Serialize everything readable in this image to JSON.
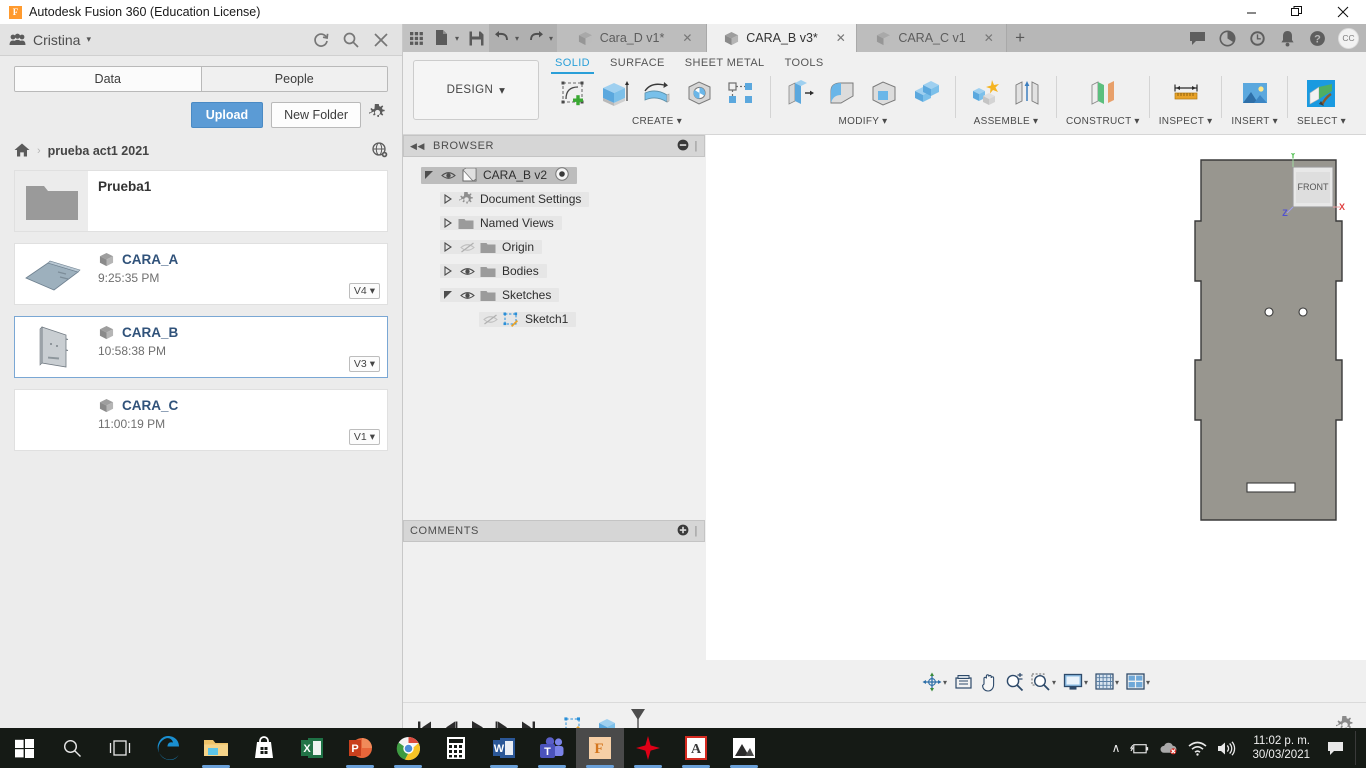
{
  "titlebar": {
    "app_title": "Autodesk Fusion 360 (Education License)",
    "logo_letter": "F",
    "minimize": "—",
    "maximize": "❐",
    "close": "✕"
  },
  "data_panel": {
    "user_name": "Cristina",
    "user_caret": "▾",
    "refresh_icon": "refresh-icon",
    "search_icon": "search-icon",
    "close_icon": "close-icon",
    "tabs": [
      {
        "label": "Data",
        "active": true
      },
      {
        "label": "People",
        "active": false
      }
    ],
    "upload_label": "Upload",
    "new_folder_label": "New Folder",
    "settings_icon": "gear-icon",
    "breadcrumb": {
      "home_icon": "home-icon",
      "separator": "›",
      "current": "prueba act1 2021",
      "globe_icon": "globe-icon"
    },
    "items": [
      {
        "name": "Prueba1",
        "type": "folder",
        "time": "",
        "version": ""
      },
      {
        "name": "CARA_A",
        "type": "file",
        "time": "9:25:35 PM",
        "version": "V4"
      },
      {
        "name": "CARA_B",
        "type": "file",
        "time": "10:58:38 PM",
        "version": "V3",
        "selected": true
      },
      {
        "name": "CARA_C",
        "type": "file",
        "time": "11:00:19 PM",
        "version": "V1"
      }
    ],
    "version_caret": "▾"
  },
  "quick_access": {
    "grid_icon": "app-grid-icon",
    "file_icon": "new-file-icon",
    "save_icon": "save-icon",
    "undo_icon": "undo-icon",
    "redo_icon": "redo-icon",
    "caret": "▾"
  },
  "document_tabs": [
    {
      "label": "Cara_D v1*",
      "active": false,
      "close": "✕"
    },
    {
      "label": "CARA_B v3*",
      "active": true,
      "close": "✕"
    },
    {
      "label": "CARA_C v1",
      "active": false,
      "close": "✕"
    }
  ],
  "tab_add": "+",
  "top_right_icons": [
    "comments-icon",
    "job-status-icon",
    "recent-icon",
    "notifications-icon",
    "help-icon"
  ],
  "avatar_initials": "CC",
  "ribbon": {
    "workspace_label": "DESIGN",
    "workspace_caret": "▾",
    "tabs": [
      {
        "label": "SOLID",
        "active": true
      },
      {
        "label": "SURFACE",
        "active": false
      },
      {
        "label": "SHEET METAL",
        "active": false
      },
      {
        "label": "TOOLS",
        "active": false
      }
    ],
    "groups": [
      {
        "label": "CREATE",
        "caret": "▾",
        "icons": [
          "create-sketch-icon",
          "extrude-icon",
          "revolve-icon",
          "sweep-icon",
          "pattern-icon"
        ]
      },
      {
        "label": "MODIFY",
        "caret": "▾",
        "icons": [
          "press-pull-icon",
          "fillet-icon",
          "shell-icon",
          "combine-icon"
        ]
      },
      {
        "label": "ASSEMBLE",
        "caret": "▾",
        "icons": [
          "new-component-icon",
          "joint-icon"
        ]
      },
      {
        "label": "CONSTRUCT",
        "caret": "▾",
        "icons": [
          "offset-plane-icon"
        ]
      },
      {
        "label": "INSPECT",
        "caret": "▾",
        "icons": [
          "measure-icon"
        ]
      },
      {
        "label": "INSERT",
        "caret": "▾",
        "icons": [
          "insert-image-icon"
        ]
      },
      {
        "label": "SELECT",
        "caret": "▾",
        "icons": [
          "select-icon"
        ]
      }
    ]
  },
  "browser": {
    "title": "BROWSER",
    "collapse_icon": "collapse-left-icon",
    "minimize_icon": "minus-circle-icon",
    "nodes": [
      {
        "label": "CARA_B v2",
        "indent": 0,
        "expander": "expanded",
        "eye": "visible",
        "icon": "component-icon",
        "root": true,
        "activate": "activate-dot-icon"
      },
      {
        "label": "Document Settings",
        "indent": 1,
        "expander": "collapsed",
        "eye": "none",
        "icon": "gear-icon"
      },
      {
        "label": "Named Views",
        "indent": 1,
        "expander": "collapsed",
        "eye": "none",
        "icon": "folder-icon"
      },
      {
        "label": "Origin",
        "indent": 1,
        "expander": "collapsed",
        "eye": "hidden",
        "icon": "folder-icon"
      },
      {
        "label": "Bodies",
        "indent": 1,
        "expander": "collapsed",
        "eye": "visible",
        "icon": "folder-icon"
      },
      {
        "label": "Sketches",
        "indent": 1,
        "expander": "expanded",
        "eye": "visible",
        "icon": "folder-icon"
      },
      {
        "label": "Sketch1",
        "indent": 2,
        "expander": "none",
        "eye": "hidden",
        "icon": "sketch-icon"
      }
    ]
  },
  "comments": {
    "title": "COMMENTS",
    "add_icon": "plus-circle-icon"
  },
  "viewcube": {
    "face_label": "FRONT",
    "axis_x": "X",
    "axis_y": "Y",
    "axis_z": "Z",
    "color_x": "#e04040",
    "color_y": "#5ec45e",
    "color_z": "#5050d0"
  },
  "model": {
    "body_color": "#98968f",
    "edge_color": "#3a3a3a",
    "description": "flat sheet-metal face panel with two small holes and a slot"
  },
  "navbar": {
    "buttons": [
      {
        "name": "orbit-icon",
        "caret": "▾"
      },
      {
        "name": "zoom-window-icon",
        "caret": ""
      },
      {
        "name": "pan-icon",
        "caret": ""
      },
      {
        "name": "zoom-icon",
        "caret": ""
      },
      {
        "name": "fit-icon",
        "caret": "▾"
      },
      {
        "name": "display-settings-icon",
        "caret": "▾"
      },
      {
        "name": "grid-settings-icon",
        "caret": "▾"
      },
      {
        "name": "viewports-icon",
        "caret": "▾"
      }
    ]
  },
  "timeline": {
    "buttons": [
      "go-to-beginning-icon",
      "step-back-icon",
      "play-icon",
      "step-forward-icon",
      "go-to-end-icon"
    ],
    "feature_icons": [
      "sketch-feature-icon",
      "extrude-feature-icon"
    ],
    "settings_icon": "gear-icon"
  },
  "taskbar": {
    "items": [
      {
        "name": "start-button",
        "icon": "windows-logo-icon",
        "active": false,
        "running": false
      },
      {
        "name": "search-button",
        "icon": "search-icon",
        "active": false,
        "running": false
      },
      {
        "name": "task-view-button",
        "icon": "task-view-icon",
        "active": false,
        "running": false
      },
      {
        "name": "edge-button",
        "icon": "edge-icon",
        "active": false,
        "running": false
      },
      {
        "name": "explorer-button",
        "icon": "folder-icon",
        "active": false,
        "running": true
      },
      {
        "name": "store-button",
        "icon": "store-icon",
        "active": false,
        "running": false
      },
      {
        "name": "excel-button",
        "icon": "excel-icon",
        "active": false,
        "running": false
      },
      {
        "name": "powerpoint-button",
        "icon": "powerpoint-icon",
        "active": false,
        "running": true
      },
      {
        "name": "chrome-button",
        "icon": "chrome-icon",
        "active": false,
        "running": true
      },
      {
        "name": "calculator-button",
        "icon": "calculator-icon",
        "active": false,
        "running": false
      },
      {
        "name": "word-button",
        "icon": "word-icon",
        "active": false,
        "running": true
      },
      {
        "name": "teams-button",
        "icon": "teams-icon",
        "active": false,
        "running": true
      },
      {
        "name": "fusion-button",
        "icon": "fusion-icon",
        "active": true,
        "running": true
      },
      {
        "name": "vegas-button",
        "icon": "vegas-icon",
        "active": false,
        "running": true
      },
      {
        "name": "acrobat-button",
        "icon": "acrobat-icon",
        "active": false,
        "running": true
      },
      {
        "name": "photos-button",
        "icon": "photos-icon",
        "active": false,
        "running": true
      }
    ],
    "tray": {
      "chevron": "∧",
      "icons": [
        "battery-icon",
        "onedrive-icon",
        "wifi-icon",
        "volume-icon",
        "action-center-icon"
      ],
      "time": "11:02 p. m.",
      "date": "30/03/2021"
    }
  }
}
